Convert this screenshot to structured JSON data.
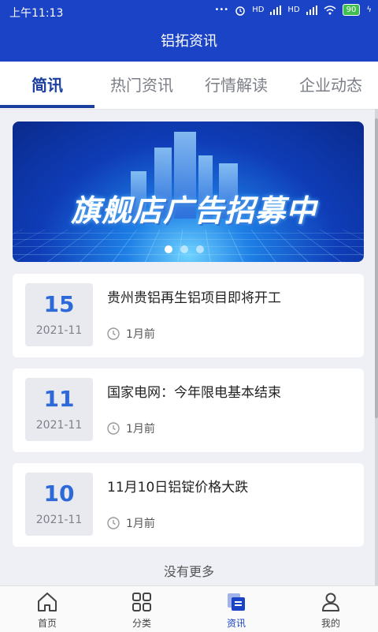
{
  "status": {
    "time": "上午11:13",
    "signal_labels": [
      "HD",
      "HD"
    ],
    "battery": "90"
  },
  "header": {
    "title": "铝拓资讯"
  },
  "tabs": [
    {
      "label": "简讯",
      "active": true
    },
    {
      "label": "热门资讯",
      "active": false
    },
    {
      "label": "行情解读",
      "active": false
    },
    {
      "label": "企业动态",
      "active": false
    }
  ],
  "banner": {
    "headline": "旗舰店广告招募中",
    "slides": 3,
    "current": 1
  },
  "news": [
    {
      "day": "15",
      "ym": "2021-11",
      "title": "贵州贵铝再生铝项目即将开工",
      "ago": "1月前"
    },
    {
      "day": "11",
      "ym": "2021-11",
      "title": "国家电网：今年限电基本结束",
      "ago": "1月前"
    },
    {
      "day": "10",
      "ym": "2021-11",
      "title": "11月10日铝锭价格大跌",
      "ago": "1月前"
    }
  ],
  "footer_note": "没有更多",
  "bottom_nav": [
    {
      "label": "首页",
      "icon": "home-icon"
    },
    {
      "label": "分类",
      "icon": "grid-icon"
    },
    {
      "label": "资讯",
      "icon": "news-icon",
      "active": true
    },
    {
      "label": "我的",
      "icon": "user-icon"
    }
  ],
  "colors": {
    "brand": "#1a43c6",
    "tab_active": "#1b3f9e",
    "date_day": "#2d69d8"
  }
}
